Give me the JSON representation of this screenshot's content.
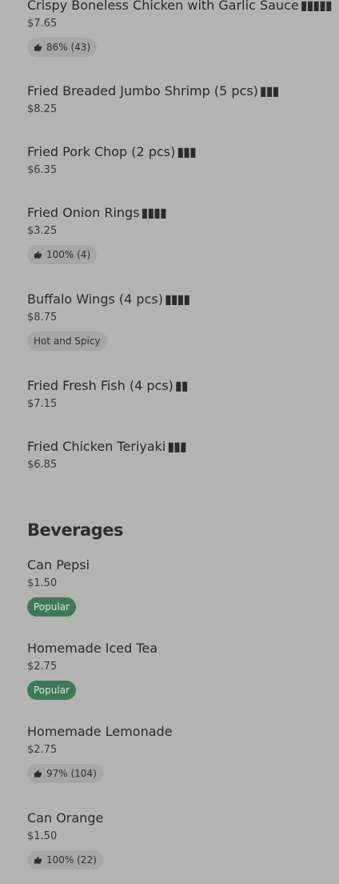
{
  "colors": {
    "background": "#b3b3b3",
    "badge_bg": "#a6a6a6",
    "popular_bg": "#3f7a57",
    "popular_text": "#d8e6dc"
  },
  "items_top": [
    {
      "name": "Crispy Boneless Chicken with Garlic Sauce",
      "cjk": "▮▮▮▮▮",
      "price": "$7.65",
      "badge": "86% (43)",
      "badge_type": "rating"
    },
    {
      "name": "Fried Breaded Jumbo Shrimp (5 pcs)",
      "cjk": "▮▮▮",
      "price": "$8.25"
    },
    {
      "name": "Fried Pork Chop (2 pcs)",
      "cjk": "▮▮▮",
      "price": "$6.35"
    },
    {
      "name": "Fried Onion Rings",
      "cjk": "▮▮▮▮",
      "price": "$3.25",
      "badge": "100% (4)",
      "badge_type": "rating"
    },
    {
      "name": "Buffalo Wings (4 pcs)",
      "cjk": "▮▮▮▮",
      "price": "$8.75",
      "badge": "Hot and Spicy",
      "badge_type": "tag"
    },
    {
      "name": "Fried Fresh Fish (4 pcs)",
      "cjk": "▮▮",
      "price": "$7.15"
    },
    {
      "name": "Fried Chicken Teriyaki",
      "cjk": "▮▮▮",
      "price": "$6.85"
    }
  ],
  "beverages": {
    "title": "Beverages",
    "items": [
      {
        "name": "Can Pepsi",
        "price": "$1.50",
        "badge": "Popular",
        "badge_type": "popular"
      },
      {
        "name": "Homemade Iced Tea",
        "price": "$2.75",
        "badge": "Popular",
        "badge_type": "popular"
      },
      {
        "name": "Homemade Lemonade",
        "price": "$2.75",
        "badge": "97% (104)",
        "badge_type": "rating"
      },
      {
        "name": "Can Orange",
        "price": "$1.50",
        "badge": "100% (22)",
        "badge_type": "rating"
      }
    ]
  },
  "icons": {
    "rating": "thumbs-up-icon"
  }
}
